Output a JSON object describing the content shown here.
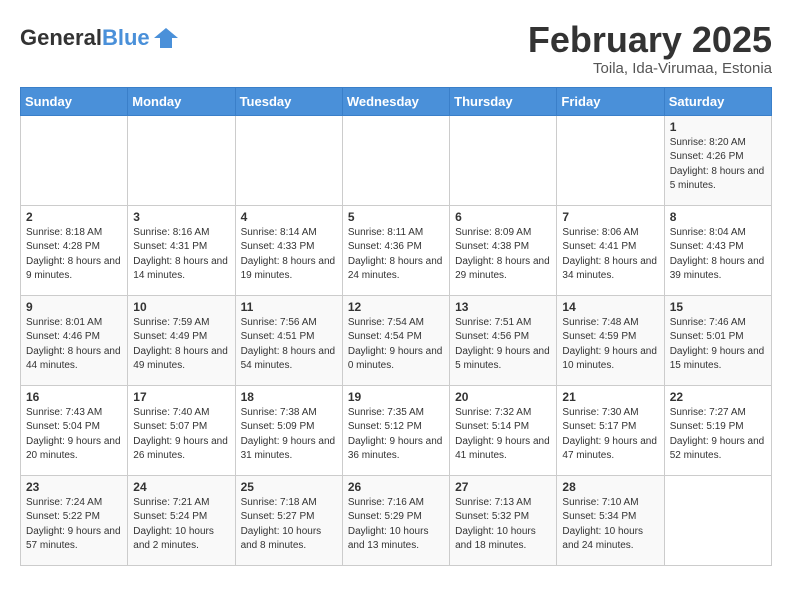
{
  "header": {
    "logo_general": "General",
    "logo_blue": "Blue",
    "title": "February 2025",
    "subtitle": "Toila, Ida-Virumaa, Estonia"
  },
  "weekdays": [
    "Sunday",
    "Monday",
    "Tuesday",
    "Wednesday",
    "Thursday",
    "Friday",
    "Saturday"
  ],
  "weeks": [
    [
      {
        "day": "",
        "info": ""
      },
      {
        "day": "",
        "info": ""
      },
      {
        "day": "",
        "info": ""
      },
      {
        "day": "",
        "info": ""
      },
      {
        "day": "",
        "info": ""
      },
      {
        "day": "",
        "info": ""
      },
      {
        "day": "1",
        "info": "Sunrise: 8:20 AM\nSunset: 4:26 PM\nDaylight: 8 hours and 5 minutes."
      }
    ],
    [
      {
        "day": "2",
        "info": "Sunrise: 8:18 AM\nSunset: 4:28 PM\nDaylight: 8 hours and 9 minutes."
      },
      {
        "day": "3",
        "info": "Sunrise: 8:16 AM\nSunset: 4:31 PM\nDaylight: 8 hours and 14 minutes."
      },
      {
        "day": "4",
        "info": "Sunrise: 8:14 AM\nSunset: 4:33 PM\nDaylight: 8 hours and 19 minutes."
      },
      {
        "day": "5",
        "info": "Sunrise: 8:11 AM\nSunset: 4:36 PM\nDaylight: 8 hours and 24 minutes."
      },
      {
        "day": "6",
        "info": "Sunrise: 8:09 AM\nSunset: 4:38 PM\nDaylight: 8 hours and 29 minutes."
      },
      {
        "day": "7",
        "info": "Sunrise: 8:06 AM\nSunset: 4:41 PM\nDaylight: 8 hours and 34 minutes."
      },
      {
        "day": "8",
        "info": "Sunrise: 8:04 AM\nSunset: 4:43 PM\nDaylight: 8 hours and 39 minutes."
      }
    ],
    [
      {
        "day": "9",
        "info": "Sunrise: 8:01 AM\nSunset: 4:46 PM\nDaylight: 8 hours and 44 minutes."
      },
      {
        "day": "10",
        "info": "Sunrise: 7:59 AM\nSunset: 4:49 PM\nDaylight: 8 hours and 49 minutes."
      },
      {
        "day": "11",
        "info": "Sunrise: 7:56 AM\nSunset: 4:51 PM\nDaylight: 8 hours and 54 minutes."
      },
      {
        "day": "12",
        "info": "Sunrise: 7:54 AM\nSunset: 4:54 PM\nDaylight: 9 hours and 0 minutes."
      },
      {
        "day": "13",
        "info": "Sunrise: 7:51 AM\nSunset: 4:56 PM\nDaylight: 9 hours and 5 minutes."
      },
      {
        "day": "14",
        "info": "Sunrise: 7:48 AM\nSunset: 4:59 PM\nDaylight: 9 hours and 10 minutes."
      },
      {
        "day": "15",
        "info": "Sunrise: 7:46 AM\nSunset: 5:01 PM\nDaylight: 9 hours and 15 minutes."
      }
    ],
    [
      {
        "day": "16",
        "info": "Sunrise: 7:43 AM\nSunset: 5:04 PM\nDaylight: 9 hours and 20 minutes."
      },
      {
        "day": "17",
        "info": "Sunrise: 7:40 AM\nSunset: 5:07 PM\nDaylight: 9 hours and 26 minutes."
      },
      {
        "day": "18",
        "info": "Sunrise: 7:38 AM\nSunset: 5:09 PM\nDaylight: 9 hours and 31 minutes."
      },
      {
        "day": "19",
        "info": "Sunrise: 7:35 AM\nSunset: 5:12 PM\nDaylight: 9 hours and 36 minutes."
      },
      {
        "day": "20",
        "info": "Sunrise: 7:32 AM\nSunset: 5:14 PM\nDaylight: 9 hours and 41 minutes."
      },
      {
        "day": "21",
        "info": "Sunrise: 7:30 AM\nSunset: 5:17 PM\nDaylight: 9 hours and 47 minutes."
      },
      {
        "day": "22",
        "info": "Sunrise: 7:27 AM\nSunset: 5:19 PM\nDaylight: 9 hours and 52 minutes."
      }
    ],
    [
      {
        "day": "23",
        "info": "Sunrise: 7:24 AM\nSunset: 5:22 PM\nDaylight: 9 hours and 57 minutes."
      },
      {
        "day": "24",
        "info": "Sunrise: 7:21 AM\nSunset: 5:24 PM\nDaylight: 10 hours and 2 minutes."
      },
      {
        "day": "25",
        "info": "Sunrise: 7:18 AM\nSunset: 5:27 PM\nDaylight: 10 hours and 8 minutes."
      },
      {
        "day": "26",
        "info": "Sunrise: 7:16 AM\nSunset: 5:29 PM\nDaylight: 10 hours and 13 minutes."
      },
      {
        "day": "27",
        "info": "Sunrise: 7:13 AM\nSunset: 5:32 PM\nDaylight: 10 hours and 18 minutes."
      },
      {
        "day": "28",
        "info": "Sunrise: 7:10 AM\nSunset: 5:34 PM\nDaylight: 10 hours and 24 minutes."
      },
      {
        "day": "",
        "info": ""
      }
    ]
  ]
}
